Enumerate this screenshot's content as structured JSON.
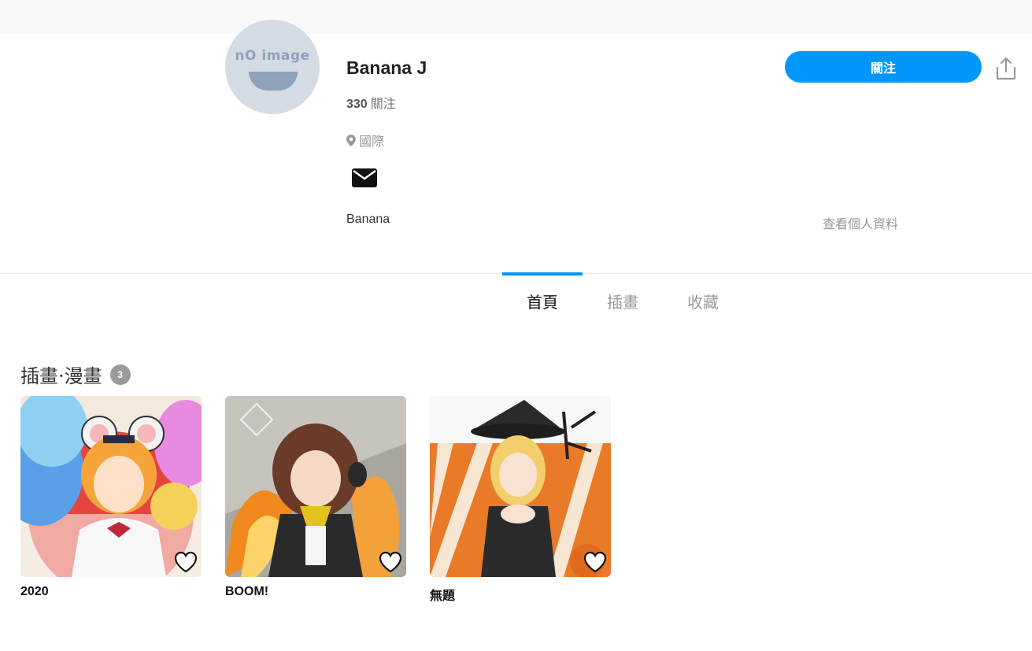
{
  "profile": {
    "avatar_text": "nO image",
    "name": "Banana J",
    "followers_count": "330",
    "followers_label": "關注",
    "location": "國際",
    "bio": "Banana",
    "view_profile": "查看個人資料",
    "follow_button": "關注"
  },
  "tabs": [
    {
      "label": "首頁",
      "active": true
    },
    {
      "label": "插畫",
      "active": false
    },
    {
      "label": "收藏",
      "active": false
    }
  ],
  "section": {
    "title": "插畫·漫畫",
    "count": "3"
  },
  "works": [
    {
      "title": "2020"
    },
    {
      "title": "BOOM!"
    },
    {
      "title": "無題"
    }
  ],
  "colors": {
    "accent": "#0096fa",
    "badge": "#9a9a9a"
  },
  "icons": [
    "location-pin-icon",
    "mail-icon",
    "share-icon",
    "heart-icon"
  ]
}
